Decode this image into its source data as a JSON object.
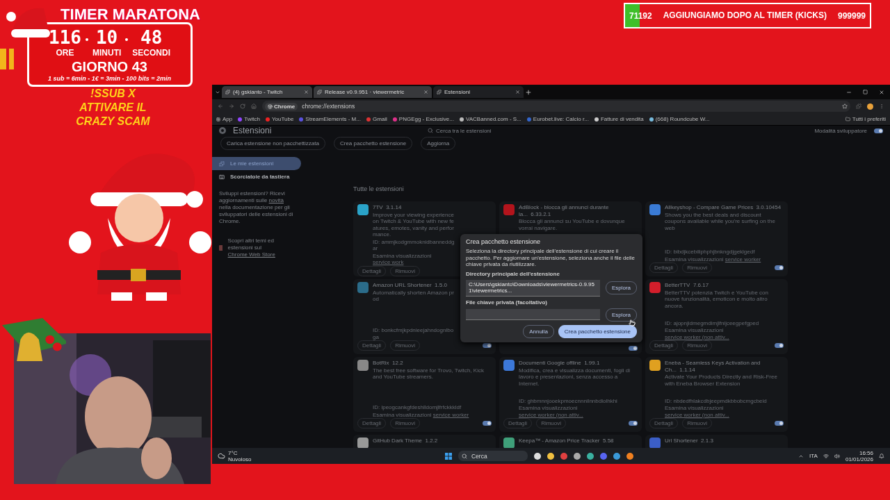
{
  "overlay": {
    "title": "TIMER MARATONA",
    "timer": [
      {
        "value": "116",
        "unit": "ORE"
      },
      {
        "value": "10",
        "unit": "MINUTI"
      },
      {
        "value": "48",
        "unit": "SECONDI"
      }
    ],
    "day": "GIORNO 43",
    "rates": "1 sub = 6min - 1€ = 3min - 100 bits = 2min",
    "promo": [
      "!SSUB X",
      "ATTIVARE IL",
      "CRAZY SCAM"
    ]
  },
  "banner": {
    "count": "71192",
    "text": "AGGIUNGIAMO DOPO AL TIMER (KICKS)",
    "goal": "999999",
    "level": 0.06
  },
  "browser": {
    "tabs": [
      {
        "title": "(4) gskianto - Twitch",
        "selected": false
      },
      {
        "title": "Release v0.9.951 · viewermetric",
        "selected": false
      },
      {
        "title": "Estensioni",
        "selected": true
      }
    ],
    "chip": "Chrome",
    "url": "chrome://extensions",
    "bookmarks": [
      "App",
      "Twitch",
      "YouTube",
      "StreamElements - M...",
      "Gmail",
      "PNGEgg - Exclusive...",
      "VACBanned.com - S...",
      "Eurobet.live: Calcio r...",
      "Fatture di vendita",
      "(668) Roundcube W..."
    ],
    "all_bookmarks": "Tutti i preferiti"
  },
  "page": {
    "title": "Estensioni",
    "search": {
      "placeholder": "Cerca tra le estensioni"
    },
    "dev_mode": {
      "label": "Modalità sviluppatore",
      "on": true
    },
    "actions": [
      "Carica estensione non pacchettizzata",
      "Crea pacchetto estensione",
      "Aggiorna"
    ],
    "sidebar": {
      "items": [
        {
          "label": "Le mie estensioni",
          "selected": true
        },
        {
          "label": "Scorciatoie da tastiera",
          "selected": false
        }
      ],
      "note": {
        "before": "Sviluppi estensioni? Ricevi aggiornamenti sulle",
        "link": "novità",
        "after": "nella documentazione per gli sviluppatori delle estensioni di Chrome."
      },
      "store": {
        "before": "Scopri altri temi ed estensioni sul",
        "link": "Chrome Web Store"
      }
    },
    "section": "Tutte le estensioni",
    "cards": [
      {
        "name": "7TV",
        "version": "3.1.14",
        "description": "Improve your viewing experience on Twitch & YouTube with new features, emotes, vanity and performance.",
        "id": "ID: ammjkodgmmoknidbanneddgar",
        "inspect": "Esamina visualizzazioni",
        "worker": "service work",
        "buttons": [
          "Dettagli",
          "Rimuovi"
        ],
        "partly_covered": true
      },
      {
        "name": "AdBlock - blocca gli annunci durante la...",
        "version": "6.33.2.1",
        "description": "Blocca gli annunci su YouTube e dovunque vorrai navigare."
      },
      {
        "name": "Allkeyshop - Compare Game Prices",
        "version": "3.0.10454",
        "description": "Shows you the best deals and discount coupons available while you're surfing on the web",
        "id": "ID: bibdjkcebiliphphjbnkngdjgeklgedf",
        "inspect": "Esamina visualizzazioni",
        "worker": "service worker",
        "buttons": [
          "Dettagli",
          "Rimuovi"
        ],
        "enabled": true
      },
      {
        "name": "Amazon URL Shortener",
        "version": "1.5.0",
        "description": "Automatically shorten Amazon prod",
        "id": "ID: bonkcfmjkpdnieejahndognlboga",
        "buttons": [
          "Dettagli",
          "Rimuovi"
        ],
        "enabled": true,
        "partly_covered": true
      },
      {
        "enabled": true
      },
      {
        "name": "BetterTTV",
        "version": "7.6.17",
        "description": "BetterTTV potenzia Twitch e YouTube con nuove funzionalità, emoticon e molto altro ancora.",
        "id": "ID: ajopnjidmegmdimjlfnijceegpefgped",
        "inspect": "Esamina visualizzazioni",
        "worker": "service worker (non attiv...",
        "buttons": [
          "Dettagli",
          "Rimuovi"
        ],
        "enabled": true
      },
      {
        "name": "BotRix",
        "version": "12.2",
        "description": "The best free software for Trovo, Twitch, Kick and YouTube streamers.",
        "id": "ID: ipeogcankgfdeshlldomjlfrfckkkldf",
        "inspect": "Esamina visualizzazioni",
        "worker": "service worker",
        "buttons": [
          "Dettagli",
          "Rimuovi"
        ],
        "enabled": true
      },
      {
        "name": "Documenti Google offline",
        "version": "1.99.1",
        "description": "Modifica, crea e visualizza documenti, fogli di lavoro e presentazioni, senza accesso a Internet.",
        "id": "ID: ghbmnnjooekpmoecnnnilnnbdlolhkhi",
        "inspect": "Esamina visualizzazioni",
        "worker": "service worker (non attiv...",
        "buttons": [
          "Dettagli",
          "Rimuovi"
        ],
        "enabled": true
      },
      {
        "name": "Eneba - Seamless Keys Activation and Ch...",
        "version": "1.1.14",
        "description": "Activate Your Products Directly and Risk-Free with Eneba Browser Extension",
        "id": "ID: nbdedfhlakcdbjeepmdkbbobcmgcbeid",
        "inspect": "Esamina visualizzazioni",
        "worker": "service worker (non attiv...",
        "buttons": [
          "Dettagli",
          "Rimuovi"
        ],
        "enabled": true
      },
      {
        "name": "GitHub Dark Theme",
        "version": "1.2.2"
      },
      {
        "name": "Keepa™ - Amazon Price Tracker",
        "version": "5.58"
      },
      {
        "name": "Url Shortener",
        "version": "2.1.3"
      }
    ],
    "dialog": {
      "title": "Crea pacchetto estensione",
      "description": "Seleziona la directory principale dell'estensione di cui creare il pacchetto. Per aggiornare un'estensione, seleziona anche il file delle chiave privata da riutilizzare.",
      "fields": [
        {
          "label": "Directory principale dell'estensione",
          "value": "C:\\Users\\gskianto\\Downloads\\viewermetrics-0.9.951\\viewermetrics...",
          "button": "Esplora"
        },
        {
          "label": "File chiave privata (facoltativo)",
          "button": "Esplora"
        }
      ],
      "cancel": "Annulla",
      "confirm": "Crea pacchetto estensione"
    }
  },
  "taskbar": {
    "temperature": "7°C",
    "weather": "Nuvoloso",
    "search": "Cerca",
    "language": "ITA",
    "time": "16:56",
    "date": "01/01/2026"
  }
}
